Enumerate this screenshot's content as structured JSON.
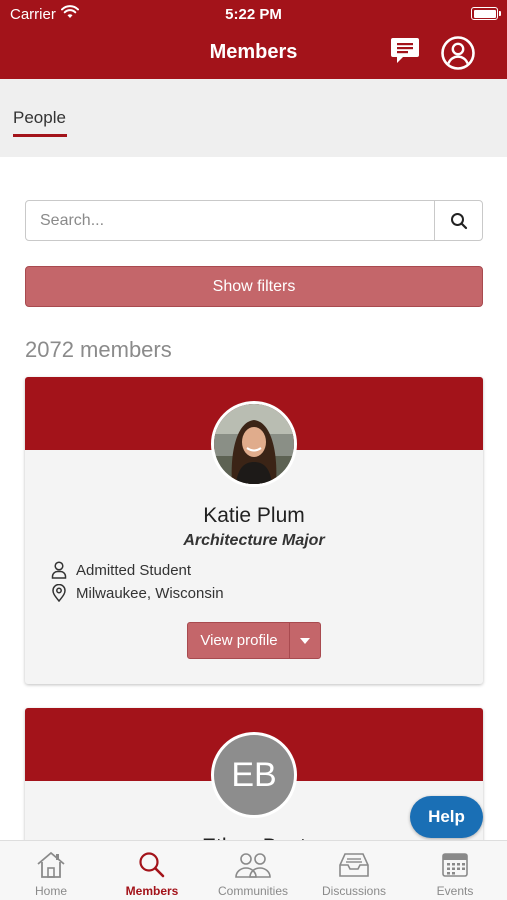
{
  "status_bar": {
    "carrier": "Carrier",
    "time": "5:22 PM"
  },
  "header": {
    "title": "Members"
  },
  "tabs": [
    {
      "label": "People",
      "active": true
    }
  ],
  "search": {
    "placeholder": "Search...",
    "value": ""
  },
  "filters": {
    "label": "Show filters"
  },
  "member_count": "2072 members",
  "members": [
    {
      "name": "Katie Plum",
      "major": "Architecture Major",
      "status": "Admitted Student",
      "location": "Milwaukee, Wisconsin",
      "view_profile_label": "View profile"
    },
    {
      "initials": "EB",
      "name": "Ethan Bent"
    }
  ],
  "help": {
    "label": "Help"
  },
  "bottom_nav": [
    {
      "label": "Home",
      "icon": "home-icon",
      "active": false
    },
    {
      "label": "Members",
      "icon": "search-icon",
      "active": true
    },
    {
      "label": "Communities",
      "icon": "people-icon",
      "active": false
    },
    {
      "label": "Discussions",
      "icon": "inbox-icon",
      "active": false
    },
    {
      "label": "Events",
      "icon": "calendar-icon",
      "active": false
    }
  ],
  "colors": {
    "brand_red": "#a3131a",
    "button_red": "#c4666a",
    "help_blue": "#1a6fb5",
    "muted_text": "#8a8a8a"
  }
}
